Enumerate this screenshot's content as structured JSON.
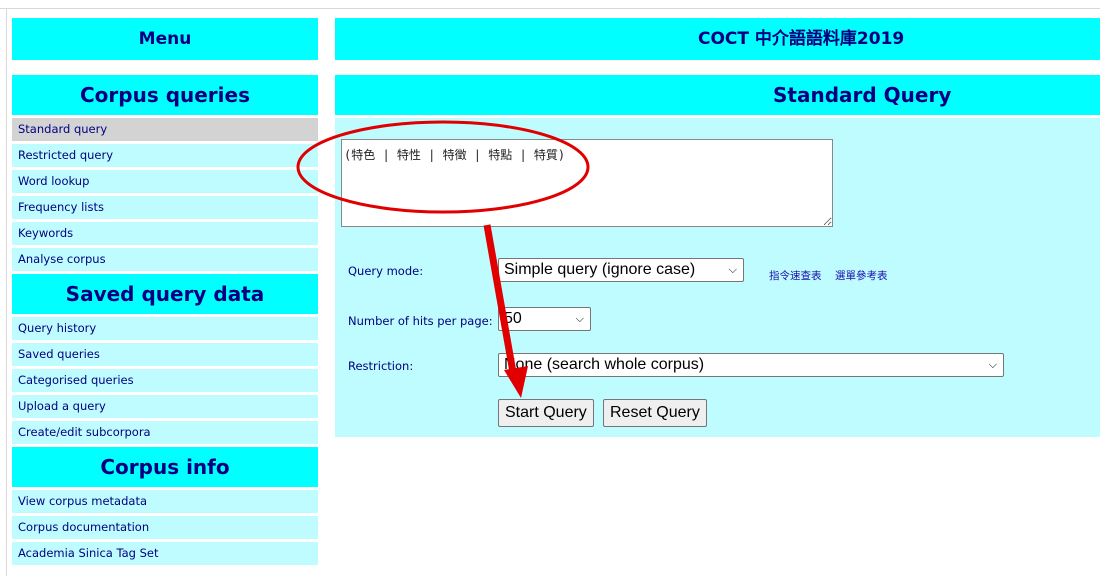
{
  "sidebar": {
    "menu_title": "Menu",
    "sections": [
      {
        "title": "Corpus queries",
        "items": [
          "Standard query",
          "Restricted query",
          "Word lookup",
          "Frequency lists",
          "Keywords",
          "Analyse corpus"
        ]
      },
      {
        "title": "Saved query data",
        "items": [
          "Query history",
          "Saved queries",
          "Categorised queries",
          "Upload a query",
          "Create/edit subcorpora"
        ]
      },
      {
        "title": "Corpus info",
        "items": [
          "View corpus metadata",
          "Corpus documentation",
          "Academia Sinica Tag Set"
        ]
      }
    ],
    "active_item": "Standard query"
  },
  "main": {
    "title": "COCT 中介語語料庫2019",
    "section_title": "Standard Query",
    "query_text": "(特色 | 特性 | 特徵 | 特點 | 特質)",
    "query_mode_label": "Query mode:",
    "query_mode_value": "Simple query (ignore case)",
    "links": [
      "指令速查表",
      "選單參考表"
    ],
    "hits_label": "Number of hits per page:",
    "hits_value": "50",
    "restriction_label": "Restriction:",
    "restriction_value": "None (search whole corpus)",
    "start_button": "Start Query",
    "reset_button": "Reset Query"
  },
  "colors": {
    "header_bg": "#00ffff",
    "item_bg": "#bffcff",
    "active_item_bg": "#d3d3d3",
    "text": "#000080",
    "annotation": "#e00000"
  },
  "icons": {
    "select_arrow": "chevron-down-icon",
    "resize_handle": "resize-grip-icon"
  }
}
